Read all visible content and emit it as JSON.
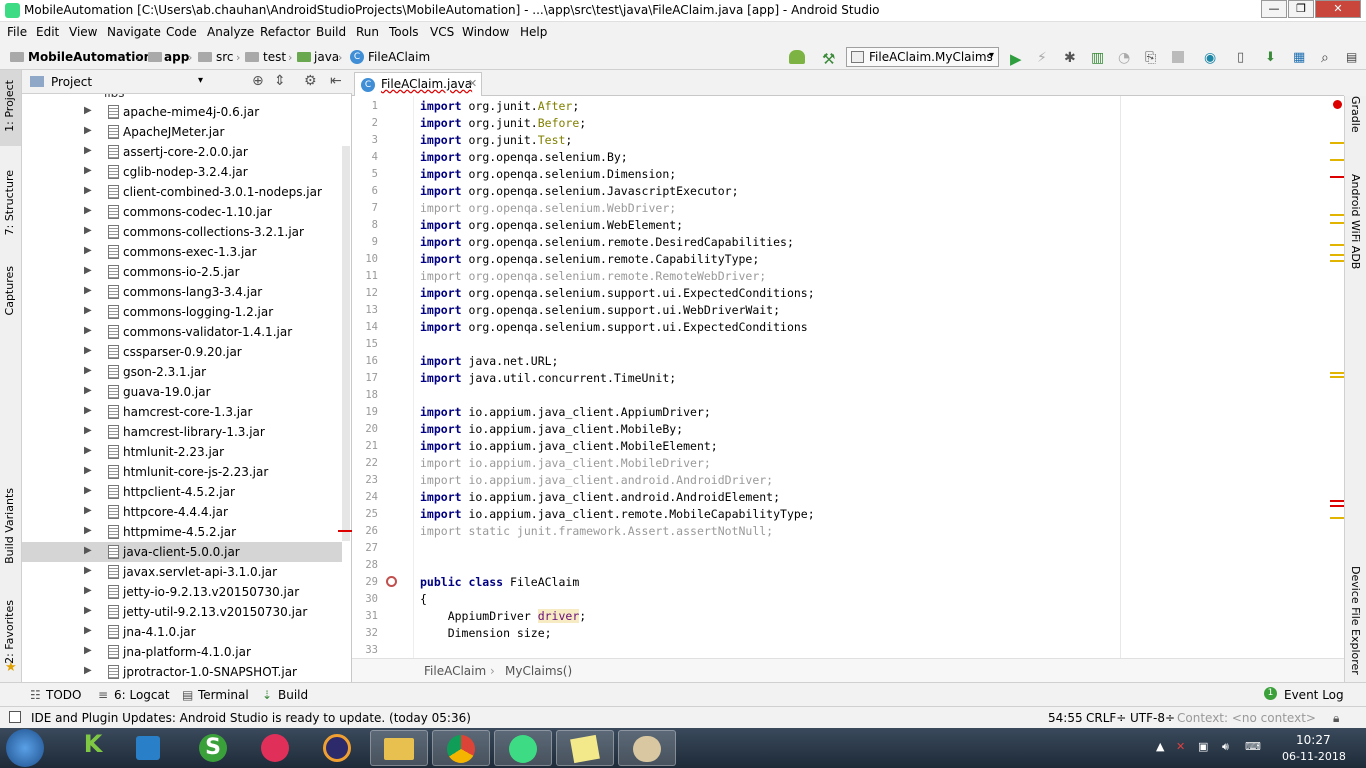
{
  "window": {
    "title": "MobileAutomation [C:\\Users\\ab.chauhan\\AndroidStudioProjects\\MobileAutomation] - ...\\app\\src\\test\\java\\FileAClaim.java [app] - Android Studio"
  },
  "menu": [
    "File",
    "Edit",
    "View",
    "Navigate",
    "Code",
    "Analyze",
    "Refactor",
    "Build",
    "Run",
    "Tools",
    "VCS",
    "Window",
    "Help"
  ],
  "breadcrumb": [
    "MobileAutomation",
    "app",
    "src",
    "test",
    "java",
    "FileAClaim"
  ],
  "run_config": "FileAClaim.MyClaims",
  "left_tools": [
    "1: Project",
    "7: Structure",
    "Captures",
    "Build Variants",
    "2: Favorites"
  ],
  "right_tools": [
    "Gradle",
    "Android WiFi ADB",
    "Device File Explorer"
  ],
  "project_panel": {
    "title": "Project",
    "partial_top": "libs",
    "items": [
      "apache-mime4j-0.6.jar",
      "ApacheJMeter.jar",
      "assertj-core-2.0.0.jar",
      "cglib-nodep-3.2.4.jar",
      "client-combined-3.0.1-nodeps.jar",
      "commons-codec-1.10.jar",
      "commons-collections-3.2.1.jar",
      "commons-exec-1.3.jar",
      "commons-io-2.5.jar",
      "commons-lang3-3.4.jar",
      "commons-logging-1.2.jar",
      "commons-validator-1.4.1.jar",
      "cssparser-0.9.20.jar",
      "gson-2.3.1.jar",
      "guava-19.0.jar",
      "hamcrest-core-1.3.jar",
      "hamcrest-library-1.3.jar",
      "htmlunit-2.23.jar",
      "htmlunit-core-js-2.23.jar",
      "httpclient-4.5.2.jar",
      "httpcore-4.4.4.jar",
      "httpmime-4.5.2.jar",
      "java-client-5.0.0.jar",
      "javax.servlet-api-3.1.0.jar",
      "jetty-io-9.2.13.v20150730.jar",
      "jetty-util-9.2.13.v20150730.jar",
      "jna-4.1.0.jar",
      "jna-platform-4.1.0.jar",
      "jprotractor-1.0-SNAPSHOT.jar"
    ],
    "selected": "java-client-5.0.0.jar"
  },
  "editor": {
    "tab": "FileAClaim.java",
    "lines": [
      {
        "n": "1",
        "kind": "imp",
        "pre": "org.junit.",
        "cls": "After",
        "post": ";"
      },
      {
        "n": "2",
        "kind": "imp",
        "pre": "org.junit.",
        "cls": "Before",
        "post": ";"
      },
      {
        "n": "3",
        "kind": "imp",
        "pre": "org.junit.",
        "cls": "Test",
        "post": ";"
      },
      {
        "n": "4",
        "kind": "imp",
        "pre": "org.openqa.selenium.By;"
      },
      {
        "n": "5",
        "kind": "imp",
        "pre": "org.openqa.selenium.Dimension;"
      },
      {
        "n": "6",
        "kind": "imp",
        "pre": "org.openqa.selenium.JavascriptExecutor;"
      },
      {
        "n": "7",
        "kind": "unused",
        "pre": "import org.openqa.selenium.WebDriver;"
      },
      {
        "n": "8",
        "kind": "imp",
        "pre": "org.openqa.selenium.WebElement;"
      },
      {
        "n": "9",
        "kind": "imp",
        "pre": "org.openqa.selenium.remote.DesiredCapabilities;"
      },
      {
        "n": "10",
        "kind": "imp",
        "pre": "org.openqa.selenium.remote.CapabilityType;"
      },
      {
        "n": "11",
        "kind": "unused",
        "pre": "import org.openqa.selenium.remote.RemoteWebDriver;"
      },
      {
        "n": "12",
        "kind": "imp",
        "pre": "org.openqa.selenium.support.ui.ExpectedConditions;"
      },
      {
        "n": "13",
        "kind": "imp",
        "pre": "org.openqa.selenium.support.ui.WebDriverWait;"
      },
      {
        "n": "14",
        "kind": "imp",
        "pre": "org.openqa.selenium.support.ui.ExpectedConditions"
      },
      {
        "n": "15",
        "kind": "blank",
        "pre": ""
      },
      {
        "n": "16",
        "kind": "imp",
        "pre": "java.net.URL;"
      },
      {
        "n": "17",
        "kind": "imp",
        "pre": "java.util.concurrent.TimeUnit;"
      },
      {
        "n": "18",
        "kind": "blank",
        "pre": ""
      },
      {
        "n": "19",
        "kind": "imp",
        "pre": "io.appium.java_client.AppiumDriver;"
      },
      {
        "n": "20",
        "kind": "imp",
        "pre": "io.appium.java_client.MobileBy;"
      },
      {
        "n": "21",
        "kind": "imp",
        "pre": "io.appium.java_client.MobileElement;"
      },
      {
        "n": "22",
        "kind": "unused",
        "pre": "import io.appium.java_client.MobileDriver;"
      },
      {
        "n": "23",
        "kind": "unused",
        "pre": "import io.appium.java_client.android.AndroidDriver;"
      },
      {
        "n": "24",
        "kind": "imp",
        "pre": "io.appium.java_client.android.AndroidElement;"
      },
      {
        "n": "25",
        "kind": "imp",
        "pre": "io.appium.java_client.remote.MobileCapabilityType;"
      },
      {
        "n": "26",
        "kind": "unused",
        "pre": "import static junit.framework.Assert.assertNotNull;"
      },
      {
        "n": "27",
        "kind": "blank",
        "pre": ""
      },
      {
        "n": "28",
        "kind": "blank",
        "pre": ""
      },
      {
        "n": "29",
        "kind": "class",
        "pre": "public class",
        "post": " FileAClaim"
      },
      {
        "n": "30",
        "kind": "plain",
        "pre": "{"
      },
      {
        "n": "31",
        "kind": "field",
        "pre": "    AppiumDriver ",
        "fld": "driver",
        "post": ";"
      },
      {
        "n": "32",
        "kind": "plain",
        "pre": "    Dimension size;"
      },
      {
        "n": "33",
        "kind": "blank",
        "pre": ""
      }
    ],
    "keyword_import": "import",
    "status_crumbs": [
      "FileAClaim",
      "MyClaims()"
    ]
  },
  "bottom_tools": {
    "todo": "TODO",
    "logcat": "6: Logcat",
    "terminal": "Terminal",
    "build": "Build",
    "event_log": "Event Log",
    "event_count": "1"
  },
  "status": {
    "message": "IDE and Plugin Updates: Android Studio is ready to update. (today 05:36)",
    "position": "54:55",
    "line_sep": "CRLF÷",
    "encoding": "UTF-8÷",
    "context": "Context: <no context>"
  },
  "taskbar": {
    "time": "10:27",
    "date": "06-11-2018"
  },
  "colors": {
    "keyword": "#000080",
    "unused": "#9a9a9a",
    "accent": "#3ddc84",
    "error": "#d00000",
    "warning": "#e0b400"
  }
}
